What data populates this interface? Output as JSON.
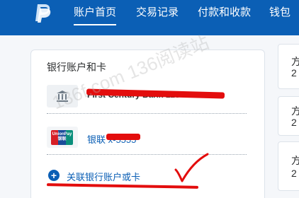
{
  "colors": {
    "brand_blue": "#0b5fb5",
    "redaction_red": "#e30d0d",
    "card_bg": "#ffffff",
    "page_bg": "#f5f7fa"
  },
  "topnav": {
    "logo_icon": "paypal-logo-icon",
    "items": [
      {
        "label": "账户首页",
        "active": true
      },
      {
        "label": "交易记录",
        "active": false
      },
      {
        "label": "付款和收款",
        "active": false
      },
      {
        "label": "钱包",
        "active": false
      }
    ]
  },
  "card": {
    "title": "银行账户和卡",
    "accounts": [
      {
        "icon": "bank-icon",
        "name": "First Century Bank 1234"
      },
      {
        "icon": "unionpay-logo-icon",
        "logo_text": "UnionPay 银联",
        "name": "银联 x-5555"
      }
    ],
    "add_link": {
      "icon": "plus-circle-icon",
      "label": "关联银行账户或卡"
    }
  },
  "watermark": "136f.com 136阅读站",
  "side_panel": {
    "rows": [
      {
        "glyph": "方",
        "sub": "2"
      },
      {
        "glyph": "方",
        "sub": "2"
      },
      {
        "glyph": "方",
        "sub": "2"
      }
    ]
  }
}
